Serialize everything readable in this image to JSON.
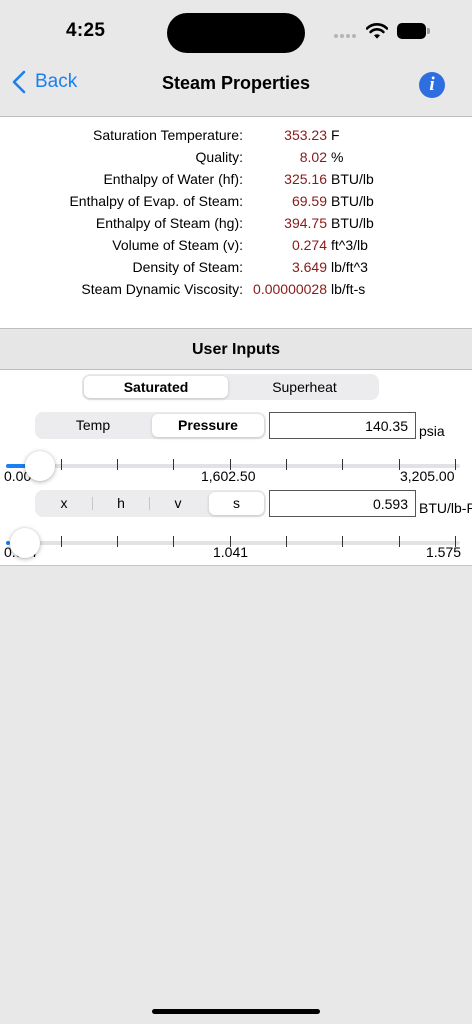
{
  "status_bar": {
    "time": "4:25"
  },
  "nav": {
    "back_label": "Back",
    "title": "Steam Properties",
    "info_label": "i"
  },
  "properties": [
    {
      "label": "Saturation Temperature:",
      "value": "353.23",
      "unit": "F"
    },
    {
      "label": "Quality:",
      "value": "8.02",
      "unit": "%"
    },
    {
      "label": "Enthalpy of Water (hf):",
      "value": "325.16",
      "unit": "BTU/lb"
    },
    {
      "label": "Enthalpy of Evap. of Steam:",
      "value": "69.59",
      "unit": "BTU/lb"
    },
    {
      "label": "Enthalpy of Steam (hg):",
      "value": "394.75",
      "unit": "BTU/lb"
    },
    {
      "label": "Volume of Steam (v):",
      "value": "0.274",
      "unit": "ft^3/lb"
    },
    {
      "label": "Density of Steam:",
      "value": "3.649",
      "unit": "lb/ft^3"
    },
    {
      "label": "Steam Dynamic Viscosity:",
      "value": "0.00000028",
      "unit": "lb/ft-s"
    }
  ],
  "inputs": {
    "header": "User Inputs",
    "mode_segment": {
      "options": [
        "Saturated",
        "Superheat"
      ],
      "selected": "Saturated"
    },
    "var_segment": {
      "options": [
        "Temp",
        "Pressure"
      ],
      "selected": "Pressure"
    },
    "pressure": {
      "value": "140.35",
      "unit": "psia"
    },
    "slider1": {
      "min_label": "0.00",
      "mid_label": "1,602.50",
      "max_label": "3,205.00",
      "fraction": 0.044
    },
    "prop_segment": {
      "options": [
        "x",
        "h",
        "v",
        "s"
      ],
      "selected": "s"
    },
    "entropy": {
      "value": "0.593",
      "unit": "BTU/lb-R"
    },
    "slider2": {
      "min_label": "0.507",
      "mid_label": "1.041",
      "max_label": "1.575",
      "fraction": 0.008
    }
  },
  "colors": {
    "accent": "#1a7ff0",
    "value_text": "#8a1a1a",
    "info_button": "#2f6ee0",
    "background": "#e8e8e8"
  }
}
